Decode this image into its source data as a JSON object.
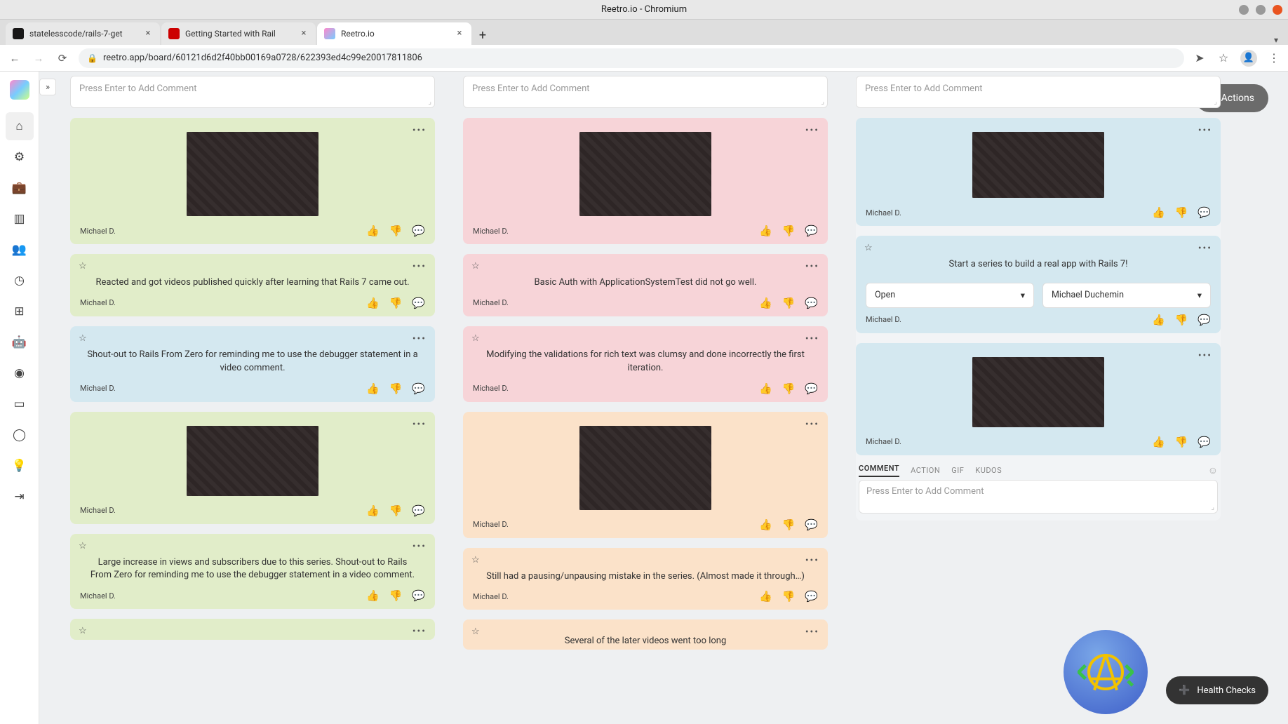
{
  "window_title": "Reetro.io - Chromium",
  "tabs": [
    {
      "title": "statelesscode/rails-7-get"
    },
    {
      "title": "Getting Started with Rail"
    },
    {
      "title": "Reetro.io"
    }
  ],
  "url": "reetro.app/board/60121d6d2f40bb00169a0728/622393ed4c99e20017811806",
  "comment_placeholder": "Press Enter to Add Comment",
  "actions_label": "Actions",
  "health_label": "Health Checks",
  "author": "Michael D.",
  "col1": {
    "cards": [
      {
        "type": "gif"
      },
      {
        "type": "text",
        "text": "Reacted and got videos published quickly after learning that Rails 7 came out."
      },
      {
        "type": "text_blue",
        "text": "Shout-out to Rails From Zero for reminding me to use the debugger statement in a video comment."
      },
      {
        "type": "gif"
      },
      {
        "type": "text",
        "text": "Large increase in views and subscribers due to this series. Shout-out to Rails From Zero for reminding me to use the debugger statement in a video comment."
      },
      {
        "type": "stub"
      }
    ]
  },
  "col2": {
    "cards": [
      {
        "type": "gif"
      },
      {
        "type": "text",
        "text": "Basic Auth with ApplicationSystemTest did not go well."
      },
      {
        "type": "text",
        "text": "Modifying the validations for rich text was clumsy and done incorrectly the first iteration."
      },
      {
        "type": "gif_peach"
      },
      {
        "type": "text_peach",
        "text": "Still had a pausing/unpausing mistake in the series. (Almost made it through…)"
      },
      {
        "type": "stub_peach",
        "text": "Several of the later videos went too long"
      }
    ]
  },
  "col3": {
    "cards": [
      {
        "type": "gif_blue"
      },
      {
        "type": "action",
        "text": "Start a series to build a real app with Rails 7!",
        "status": "Open",
        "assignee": "Michael Duchemin"
      },
      {
        "type": "gif_blue"
      }
    ],
    "composer_tabs": [
      "COMMENT",
      "ACTION",
      "GIF",
      "KUDOS"
    ]
  }
}
